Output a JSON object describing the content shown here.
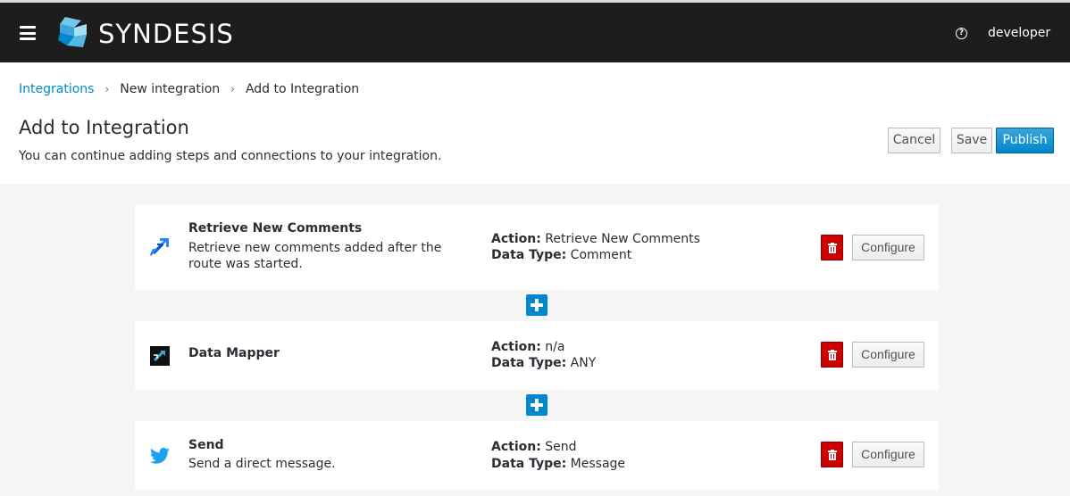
{
  "app": {
    "brand": "SYNDESIS",
    "user": "developer"
  },
  "breadcrumb": {
    "items": [
      "Integrations",
      "New integration",
      "Add to Integration"
    ]
  },
  "header": {
    "title": "Add to Integration",
    "subtitle": "You can continue adding steps and connections to your integration."
  },
  "actions": {
    "cancel": "Cancel",
    "save": "Save",
    "publish": "Publish"
  },
  "labels": {
    "action": "Action:",
    "data_type": "Data Type:",
    "configure": "Configure"
  },
  "steps": [
    {
      "icon": "jira-icon",
      "name": "Retrieve New Comments",
      "description": "Retrieve new comments added after the route was started.",
      "action": "Retrieve New Comments",
      "data_type": "Comment"
    },
    {
      "icon": "data-mapper-icon",
      "name": "Data Mapper",
      "description": "",
      "action": "n/a",
      "data_type": "ANY"
    },
    {
      "icon": "twitter-icon",
      "name": "Send",
      "description": "Send a direct message.",
      "action": "Send",
      "data_type": "Message"
    }
  ],
  "colors": {
    "navbar": "#1d1d1d",
    "link": "#0088ce",
    "primary": "#0088ce",
    "danger": "#cc0000",
    "jira": "#2684ff",
    "twitter": "#1da1f2"
  }
}
